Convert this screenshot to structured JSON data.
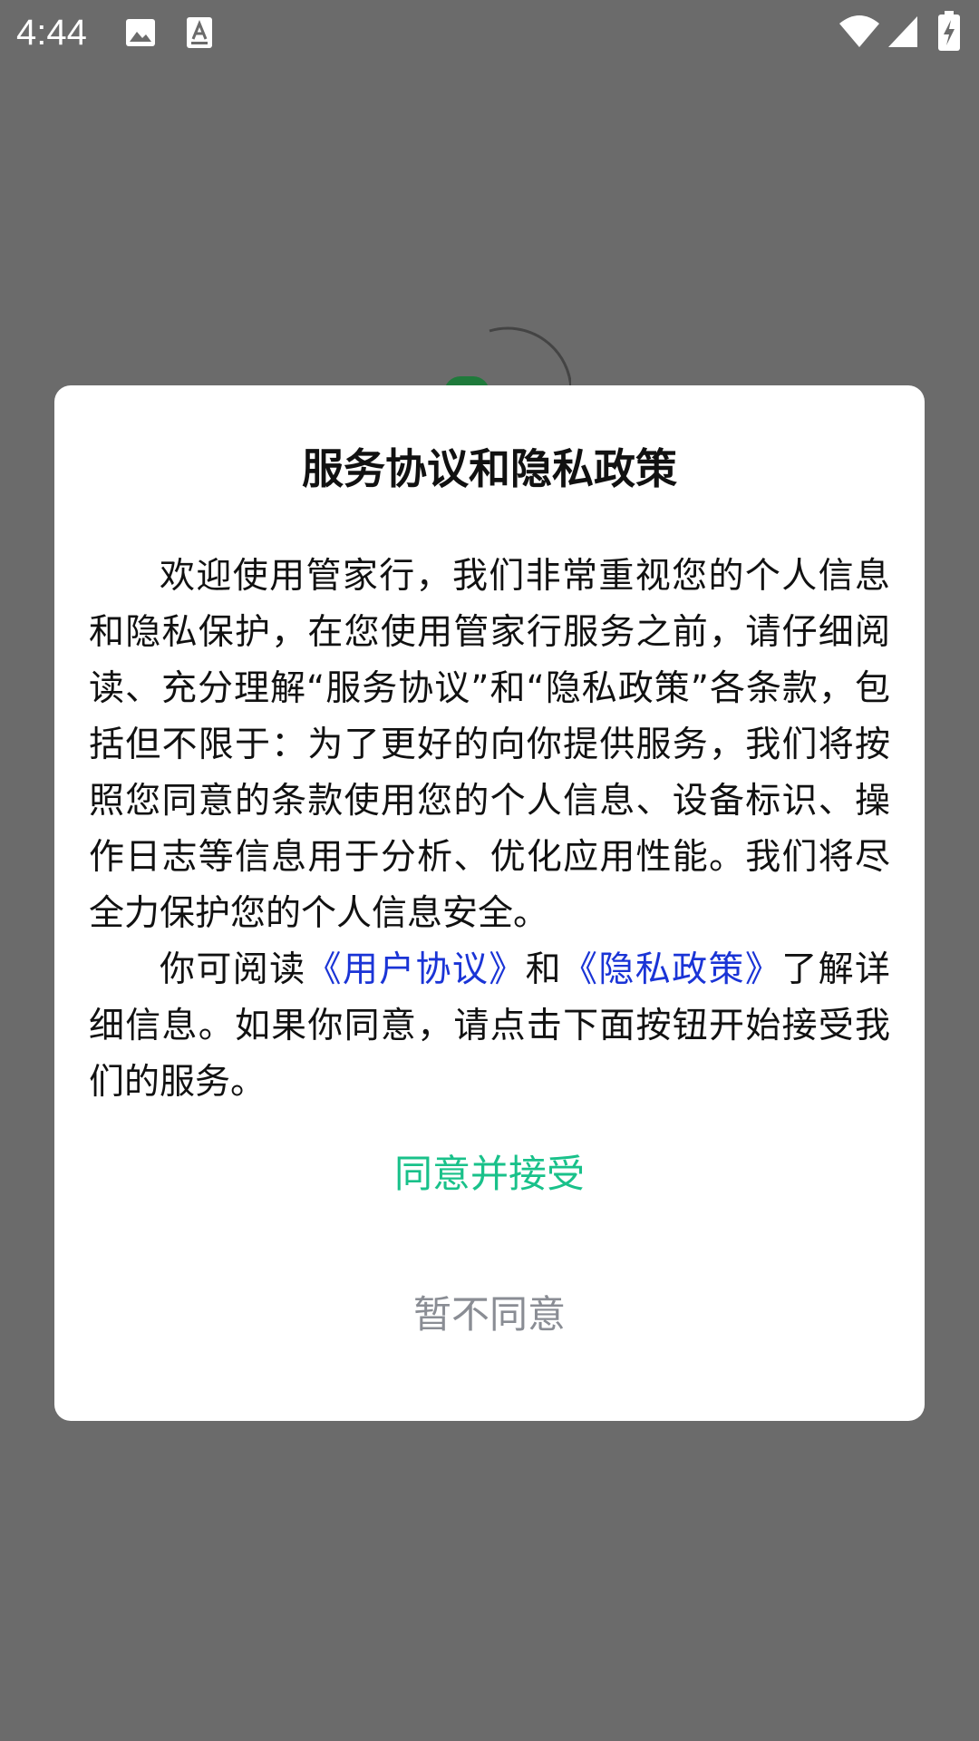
{
  "status_bar": {
    "time": "4:44",
    "icons": [
      "image-icon",
      "keyboard-icon",
      "wifi-icon",
      "signal-icon",
      "battery-charging-icon"
    ]
  },
  "dialog": {
    "title": "服务协议和隐私政策",
    "paragraph1": "欢迎使用管家行，我们非常重视您的个人信息和隐私保护，在您使用管家行服务之前，请仔细阅读、充分理解“服务协议”和“隐私政策”各条款，包括但不限于：为了更好的向你提供服务，我们将按照您同意的条款使用您的个人信息、设备标识、操作日志等信息用于分析、优化应用性能。我们将尽全力保护您的个人信息安全。",
    "paragraph2_prefix": "你可阅读",
    "user_agreement_link": "《用户协议》",
    "paragraph2_and": "和",
    "privacy_policy_link": "《隐私政策》",
    "paragraph2_suffix": "了解详细信息。如果你同意，请点击下面按钮开始接受我们的服务。",
    "agree_label": "同意并接受",
    "decline_label": "暂不同意"
  },
  "colors": {
    "overlay": "#6b6b6b",
    "link": "#1a34d6",
    "agree": "#19c18a",
    "decline": "#8a8d94"
  }
}
